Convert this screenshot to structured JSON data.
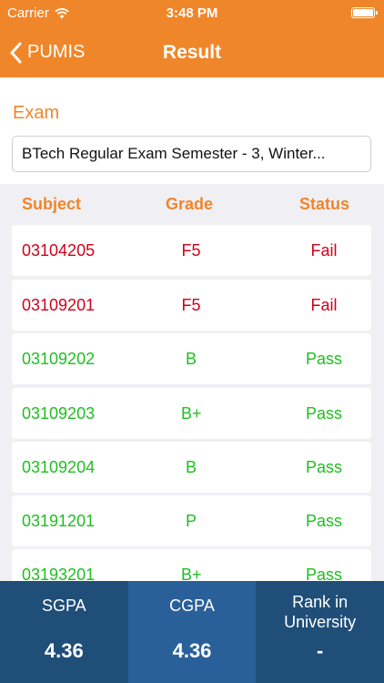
{
  "status_bar": {
    "carrier": "Carrier",
    "time": "3:48 PM"
  },
  "nav": {
    "back_label": "PUMIS",
    "title": "Result"
  },
  "exam": {
    "label": "Exam",
    "value": "BTech Regular Exam Semester - 3, Winter..."
  },
  "table": {
    "headers": [
      "Subject",
      "Grade",
      "Status"
    ],
    "rows": [
      {
        "subject": "03104205",
        "grade": "F5",
        "status": "Fail"
      },
      {
        "subject": "03109201",
        "grade": "F5",
        "status": "Fail"
      },
      {
        "subject": "03109202",
        "grade": "B",
        "status": "Pass"
      },
      {
        "subject": "03109203",
        "grade": "B+",
        "status": "Pass"
      },
      {
        "subject": "03109204",
        "grade": "B",
        "status": "Pass"
      },
      {
        "subject": "03191201",
        "grade": "P",
        "status": "Pass"
      },
      {
        "subject": "03193201",
        "grade": "B+",
        "status": "Pass"
      }
    ]
  },
  "summary": [
    {
      "label": "SGPA",
      "value": "4.36"
    },
    {
      "label": "CGPA",
      "value": "4.36"
    },
    {
      "label": "Rank in University",
      "value": "-"
    }
  ],
  "colors": {
    "accent": "#f0862a",
    "fail": "#d0021b",
    "pass": "#1fbf21",
    "footer": "#1f4e79",
    "footer_active": "#2a609a"
  },
  "icons": {
    "back": "chevron-left-icon",
    "wifi": "wifi-icon",
    "battery": "battery-icon"
  }
}
